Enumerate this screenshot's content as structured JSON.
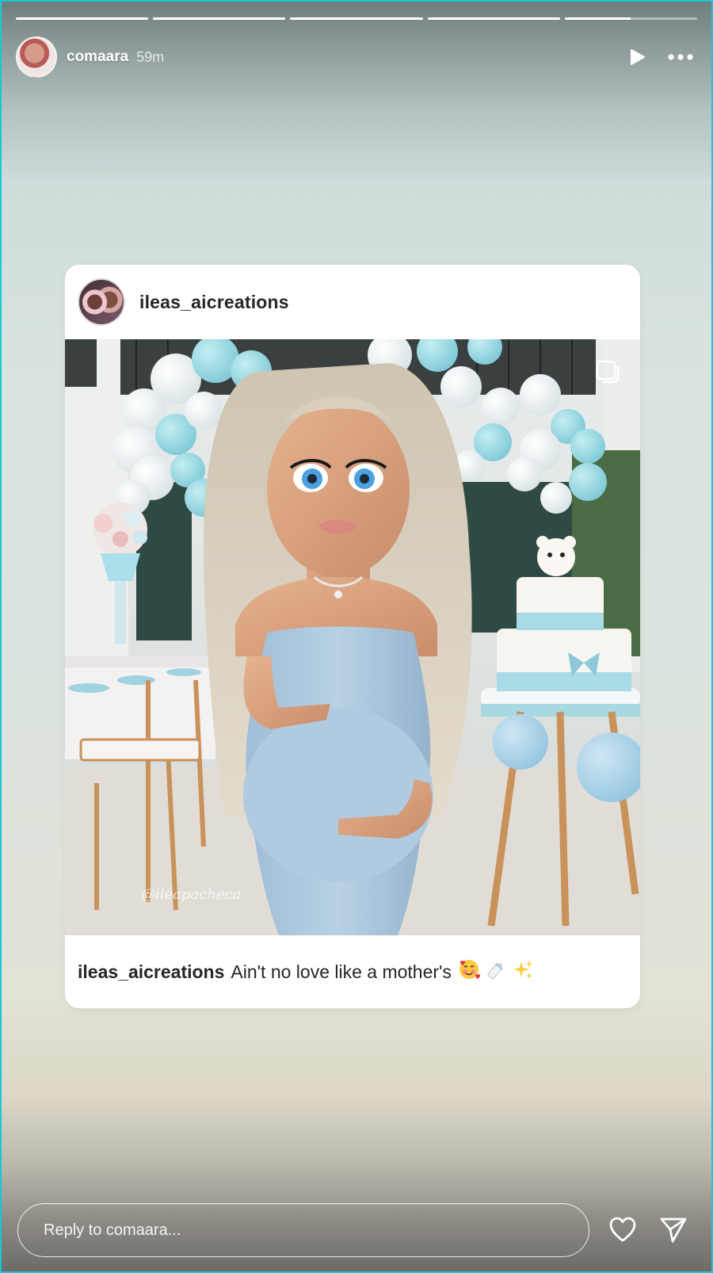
{
  "story": {
    "progress_segments": [
      1,
      1,
      1,
      1,
      0.5
    ],
    "username": "comaara",
    "time": "59m",
    "play_icon": "play-icon",
    "more_icon": "more-icon"
  },
  "post": {
    "username": "ileas_aicreations",
    "image_watermark": "@ileapacheca",
    "caption_user": "ileas_aicreations",
    "caption_text": "Ain't no love like a mother's",
    "caption_emojis": [
      "smiling-face-with-hearts",
      "baby-bottle",
      "sparkles"
    ]
  },
  "reply": {
    "placeholder": "Reply to comaara..."
  },
  "colors": {
    "accent_border": "#18c7d8",
    "dress": "#a9c6dd",
    "balloon_blue": "#8ed3dd"
  }
}
